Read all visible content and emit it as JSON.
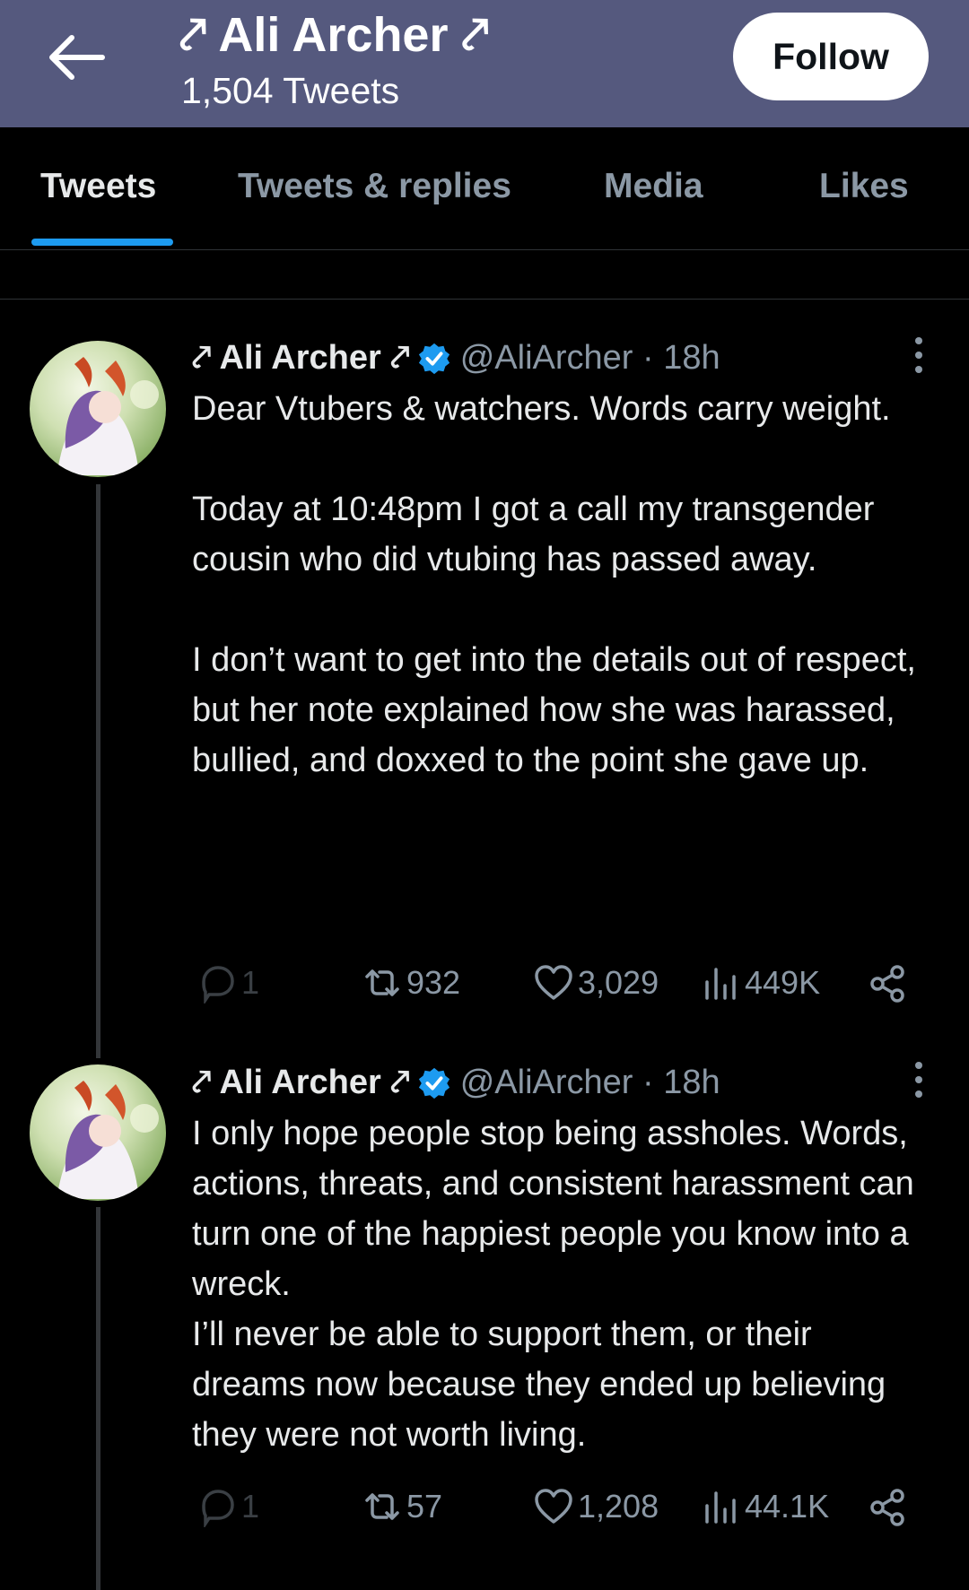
{
  "header": {
    "title": "⤤ Ali Archer ⤤",
    "tweet_count": "1,504 Tweets",
    "follow_label": "Follow",
    "background": "#55597e"
  },
  "tabs": [
    {
      "label": "Tweets",
      "active": true
    },
    {
      "label": "Tweets & replies",
      "active": false
    },
    {
      "label": "Media",
      "active": false
    },
    {
      "label": "Likes",
      "active": false
    }
  ],
  "accent": "#1d9bf0",
  "tweets": [
    {
      "name": "⤤ Ali Archer ⤤",
      "handle": "@AliArcher · 18h",
      "verified": true,
      "text": "Dear Vtubers & watchers. Words carry weight.\n\nToday at 10:48pm I got a call my transgender cousin who did vtubing has passed away.\n\nI don’t want to get into the details out of respect, but her note explained how she was harassed, bullied, and doxxed to the point she gave up.",
      "replies": "1",
      "retweets": "932",
      "likes": "3,029",
      "views": "449K"
    },
    {
      "name": "⤤ Ali Archer ⤤",
      "handle": "@AliArcher · 18h",
      "verified": true,
      "text": "I only hope people stop being assholes. Words, actions, threats, and consistent harassment can turn one of the happiest people you know into a wreck.\nI’ll never be able to support them, or their dreams now because they ended up believing they were not worth living.",
      "replies": "1",
      "retweets": "57",
      "likes": "1,208",
      "views": "44.1K"
    }
  ]
}
